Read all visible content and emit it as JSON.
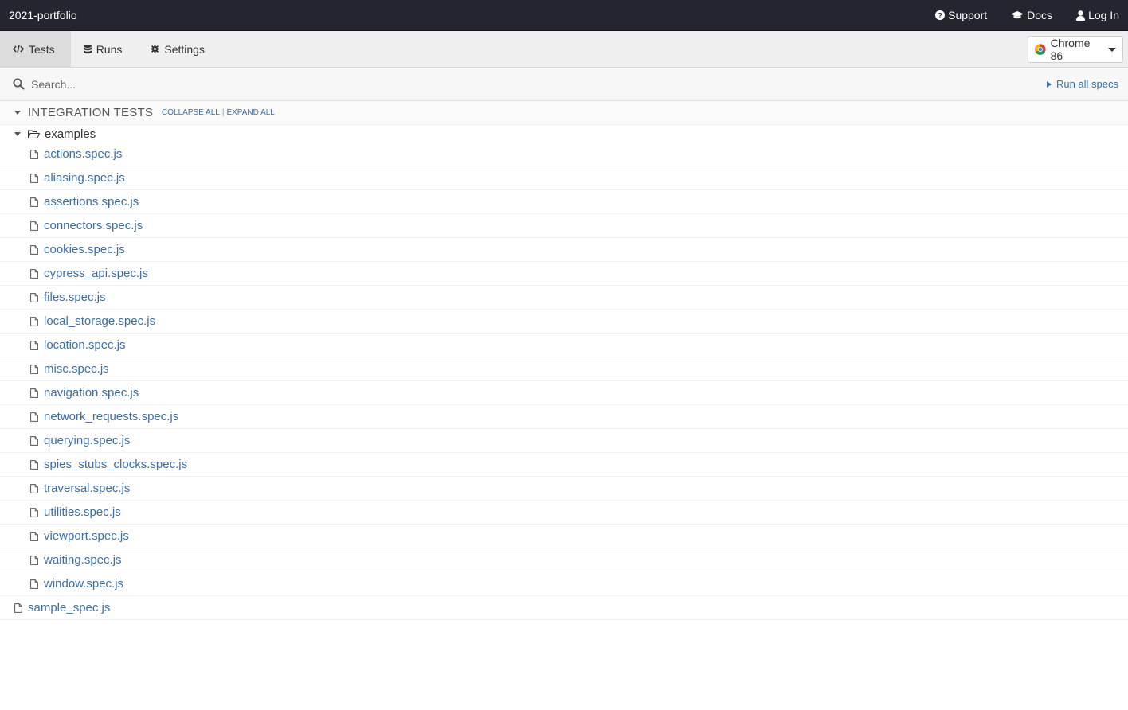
{
  "topbar": {
    "project_name": "2021-portfolio",
    "links": [
      {
        "label": "Support",
        "icon": "question-circle-icon"
      },
      {
        "label": "Docs",
        "icon": "graduation-cap-icon"
      },
      {
        "label": "Log In",
        "icon": "user-icon"
      }
    ]
  },
  "tabs": [
    {
      "label": "Tests",
      "icon": "code-icon",
      "active": true
    },
    {
      "label": "Runs",
      "icon": "database-icon",
      "active": false
    },
    {
      "label": "Settings",
      "icon": "gear-icon",
      "active": false
    }
  ],
  "browser": {
    "label": "Chrome 86",
    "icon": "chrome-icon"
  },
  "search": {
    "placeholder": "Search...",
    "value": "",
    "run_all_label": "Run all specs"
  },
  "integration": {
    "title": "INTEGRATION TESTS",
    "collapse_all": "COLLAPSE ALL",
    "separator": "|",
    "expand_all": "EXPAND ALL"
  },
  "folder": {
    "name": "examples",
    "files": [
      "actions.spec.js",
      "aliasing.spec.js",
      "assertions.spec.js",
      "connectors.spec.js",
      "cookies.spec.js",
      "cypress_api.spec.js",
      "files.spec.js",
      "local_storage.spec.js",
      "location.spec.js",
      "misc.spec.js",
      "navigation.spec.js",
      "network_requests.spec.js",
      "querying.spec.js",
      "spies_stubs_clocks.spec.js",
      "traversal.spec.js",
      "utilities.spec.js",
      "viewport.spec.js",
      "waiting.spec.js",
      "window.spec.js"
    ]
  },
  "root_files": [
    "sample_spec.js"
  ],
  "colors": {
    "topbar_bg": "#23262e",
    "link_blue": "#3c6fa6",
    "tab_active_bg": "#dcdcdc"
  }
}
